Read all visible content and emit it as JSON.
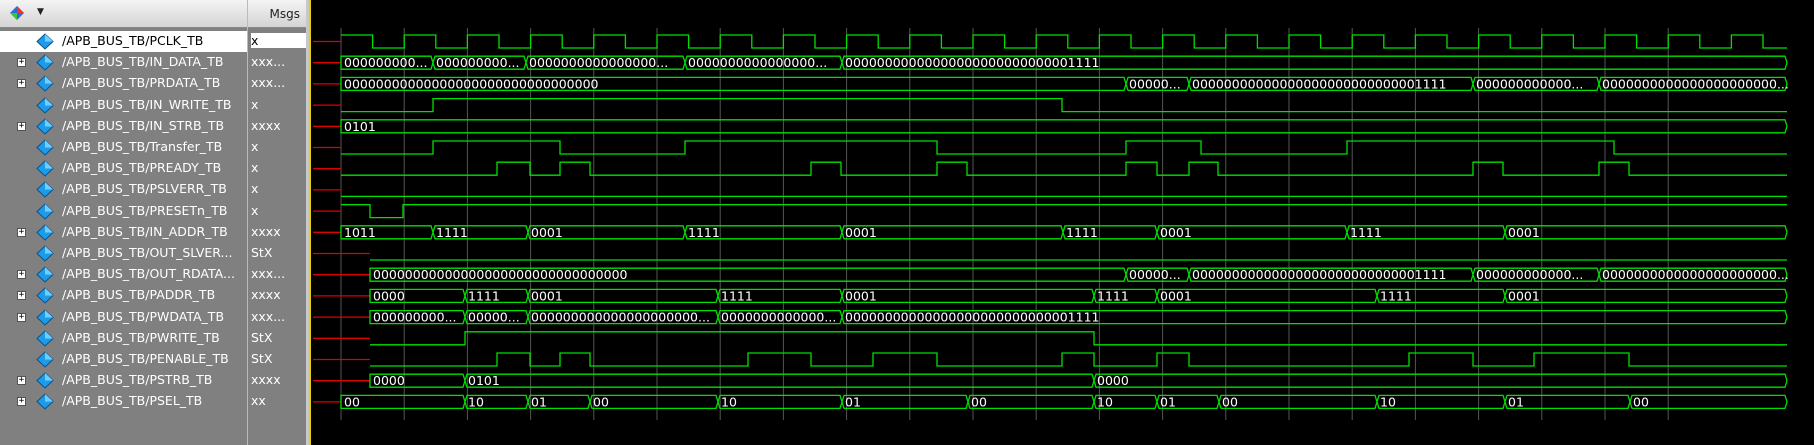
{
  "header": {
    "msgs_label": "Msgs"
  },
  "signals": [
    {
      "name": "/APB_BUS_TB/PCLK_TB",
      "value": "x",
      "expandable": false,
      "selected": true
    },
    {
      "name": "/APB_BUS_TB/IN_DATA_TB",
      "value": "xxx...",
      "expandable": true
    },
    {
      "name": "/APB_BUS_TB/PRDATA_TB",
      "value": "xxx...",
      "expandable": true
    },
    {
      "name": "/APB_BUS_TB/IN_WRITE_TB",
      "value": "x",
      "expandable": false
    },
    {
      "name": "/APB_BUS_TB/IN_STRB_TB",
      "value": "xxxx",
      "expandable": true
    },
    {
      "name": "/APB_BUS_TB/Transfer_TB",
      "value": "x",
      "expandable": false
    },
    {
      "name": "/APB_BUS_TB/PREADY_TB",
      "value": "x",
      "expandable": false
    },
    {
      "name": "/APB_BUS_TB/PSLVERR_TB",
      "value": "x",
      "expandable": false
    },
    {
      "name": "/APB_BUS_TB/PRESETn_TB",
      "value": "x",
      "expandable": false
    },
    {
      "name": "/APB_BUS_TB/IN_ADDR_TB",
      "value": "xxxx",
      "expandable": true
    },
    {
      "name": "/APB_BUS_TB/OUT_SLVER...",
      "value": "StX",
      "expandable": false
    },
    {
      "name": "/APB_BUS_TB/OUT_RDATA...",
      "value": "xxx...",
      "expandable": true
    },
    {
      "name": "/APB_BUS_TB/PADDR_TB",
      "value": "xxxx",
      "expandable": true
    },
    {
      "name": "/APB_BUS_TB/PWDATA_TB",
      "value": "xxx...",
      "expandable": true
    },
    {
      "name": "/APB_BUS_TB/PWRITE_TB",
      "value": "StX",
      "expandable": false
    },
    {
      "name": "/APB_BUS_TB/PENABLE_TB",
      "value": "StX",
      "expandable": false
    },
    {
      "name": "/APB_BUS_TB/PSTRB_TB",
      "value": "xxxx",
      "expandable": true
    },
    {
      "name": "/APB_BUS_TB/PSEL_TB",
      "value": "xx",
      "expandable": true
    }
  ],
  "bus_labels": {
    "IN_DATA_TB": [
      "000000000...",
      "000000000...",
      "0000000000000000...",
      "0000000000000000...",
      "00000000000000000000000000001111"
    ],
    "PRDATA_TB": [
      "00000000000000000000000000000000",
      "00000...",
      "00000000000000000000000000001111",
      "000000000000...",
      "0000000000000000000000..."
    ],
    "IN_STRB_TB": [
      "0101"
    ],
    "IN_ADDR_TB": [
      "1011",
      "1111",
      "0001",
      "1111",
      "0001",
      "1111",
      "0001",
      "1111",
      "0001"
    ],
    "OUT_RDATA": [
      "00000000000000000000000000000000",
      "00000...",
      "00000000000000000000000000001111",
      "000000000000...",
      "0000000000000000000000..."
    ],
    "PADDR_TB": [
      "0000",
      "1111",
      "0001",
      "1111",
      "0001",
      "1111",
      "0001",
      "1111",
      "0001"
    ],
    "PWDATA_TB": [
      "000000000...",
      "00000...",
      "000000000000000000000...",
      "0000000000000...",
      "00000000000000000000000000001111"
    ],
    "PSTRB_TB": [
      "0000",
      "0101",
      "0000"
    ],
    "PSEL_TB": [
      "00",
      "10",
      "01",
      "00",
      "10",
      "01",
      "00",
      "10",
      "01",
      "00",
      "10",
      "01",
      "00"
    ]
  },
  "colors": {
    "wave": "#00e000",
    "unknown": "#e00000",
    "grid": "#555555",
    "cursor": "#e8d000"
  }
}
